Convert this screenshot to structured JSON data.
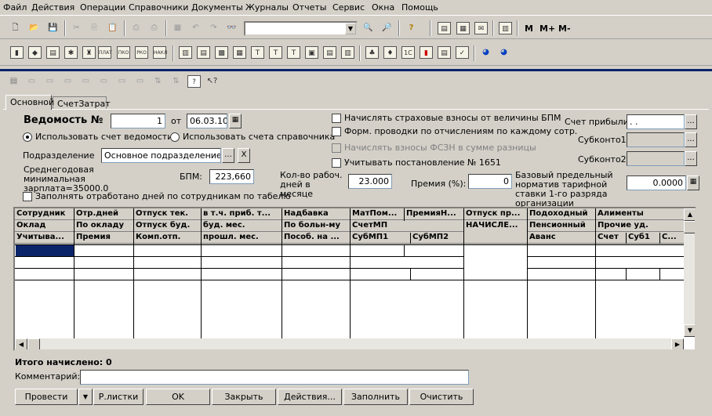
{
  "menu": [
    "Файл",
    "Действия",
    "Операции",
    "Справочники",
    "Документы",
    "Журналы",
    "Отчеты",
    "Сервис",
    "Окна",
    "Помощь"
  ],
  "toolbar_text": {
    "m": "M",
    "mplus": "M+",
    "mminus": "M-"
  },
  "toolbar2_labels": [
    "ПЛАТ",
    "ПКО",
    "РКО",
    "НАКЛ"
  ],
  "tabs": [
    "Основной",
    "СчетЗатрат"
  ],
  "form": {
    "title": "Ведомость №",
    "number": "1",
    "from_label": "от",
    "date": "06.03.10",
    "radio1": "Использовать счет ведомости",
    "radio2": "Использовать счета справочника",
    "dept_label": "Подразделение",
    "dept_value": "Основное подразделение",
    "min_wage": "Среднегодовая минимальная зарплата=35000.0",
    "bpm_label": "БПМ:",
    "bpm_value": "223,660",
    "fill_days": "Заполнять отработано дней по сотрудникам по табелю",
    "chk1": "Начислять страховые взносы от величины БПМ",
    "chk2": "Форм. проводки по отчислениям по каждому сотр.",
    "chk3": "Начислять взносы ФСЗН в сумме разницы",
    "chk4": "Учитывать постановление № 1651",
    "workdays_label": "Кол-во рабоч. дней в месяце",
    "workdays_value": "23.000",
    "bonus_label": "Премия (%):",
    "bonus_value": "0",
    "base_rate_label": "Базовый предельный норматив тарифной ставки 1-го разряда организации",
    "base_rate_value": "0.0000",
    "profit_label": "Счет прибыли:",
    "profit_value": ". .",
    "sub1_label": "Субконто1:",
    "sub2_label": "Субконто2:"
  },
  "grid": {
    "row1": [
      "Сотрудник",
      "Отр.дней",
      "Отпуск тек.",
      "в т.ч. приб. т...",
      "Надбавка",
      "МатПом...",
      "ПремияН...",
      "Отпуск пр...",
      "Подоходный",
      "Алименты"
    ],
    "row2": [
      "Оклад",
      "По окладу",
      "Отпуск буд.",
      "буд. мес.",
      "По больн-му",
      "СчетМП",
      "НАЧИСЛЕ...",
      "Пенсионный",
      "Прочие уд."
    ],
    "row3": [
      "Учитыва...",
      "Премия",
      "Комп.отп.",
      "прошл. мес.",
      "Пособ. на ...",
      "СубМП1",
      "СубМП2",
      "Аванс",
      "Счет",
      "Суб1",
      "С..."
    ]
  },
  "totals": "Итого начислено: 0",
  "comment_label": "Комментарий:",
  "buttons": [
    "Провести",
    "Р.листки",
    "OK",
    "Закрыть",
    "Действия...",
    "Заполнить",
    "Очистить"
  ]
}
